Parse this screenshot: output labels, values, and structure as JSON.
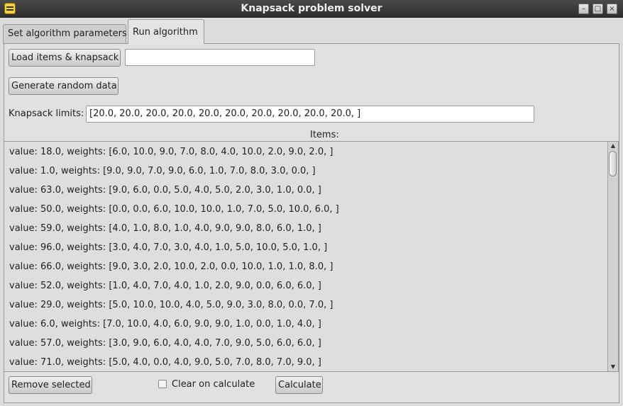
{
  "window": {
    "title": "Knapsack problem solver",
    "app_icon": "bee-icon",
    "controls": {
      "minimize": "–",
      "maximize": "□",
      "close": "×"
    }
  },
  "tabs": [
    {
      "label": "Set algorithm parameters",
      "active": false
    },
    {
      "label": "Run algorithm",
      "active": true
    }
  ],
  "toolbar": {
    "load_button": "Load items & knapsack",
    "load_path_value": "",
    "generate_button": "Generate random data"
  },
  "knapsack": {
    "label": "Knapsack limits:",
    "value": "[20.0, 20.0, 20.0, 20.0, 20.0, 20.0, 20.0, 20.0, 20.0, 20.0, ]"
  },
  "items": {
    "header": "Items:",
    "rows": [
      "value: 18.0, weights: [6.0, 10.0, 9.0, 7.0, 8.0, 4.0, 10.0, 2.0, 9.0, 2.0, ]",
      "value: 1.0, weights: [9.0, 9.0, 7.0, 9.0, 6.0, 1.0, 7.0, 8.0, 3.0, 0.0, ]",
      "value: 63.0, weights: [9.0, 6.0, 0.0, 5.0, 4.0, 5.0, 2.0, 3.0, 1.0, 0.0, ]",
      "value: 50.0, weights: [0.0, 0.0, 6.0, 10.0, 10.0, 1.0, 7.0, 5.0, 10.0, 6.0, ]",
      "value: 59.0, weights: [4.0, 1.0, 8.0, 1.0, 4.0, 9.0, 9.0, 8.0, 6.0, 1.0, ]",
      "value: 96.0, weights: [3.0, 4.0, 7.0, 3.0, 4.0, 1.0, 5.0, 10.0, 5.0, 1.0, ]",
      "value: 66.0, weights: [9.0, 3.0, 2.0, 10.0, 2.0, 0.0, 10.0, 1.0, 1.0, 8.0, ]",
      "value: 52.0, weights: [1.0, 4.0, 7.0, 4.0, 1.0, 2.0, 9.0, 0.0, 6.0, 6.0, ]",
      "value: 29.0, weights: [5.0, 10.0, 10.0, 4.0, 5.0, 9.0, 3.0, 8.0, 0.0, 7.0, ]",
      "value: 6.0, weights: [7.0, 10.0, 4.0, 6.0, 9.0, 9.0, 1.0, 0.0, 1.0, 4.0, ]",
      "value: 57.0, weights: [3.0, 9.0, 6.0, 4.0, 4.0, 7.0, 9.0, 5.0, 6.0, 6.0, ]",
      "value: 71.0, weights: [5.0, 4.0, 0.0, 4.0, 9.0, 5.0, 7.0, 8.0, 7.0, 9.0, ]"
    ]
  },
  "footer": {
    "remove_button": "Remove selected",
    "clear_checkbox_label": "Clear on calculate",
    "clear_checked": false,
    "calculate_button": "Calculate"
  },
  "icons": {
    "scroll_up": "▲",
    "scroll_down": "▼"
  }
}
